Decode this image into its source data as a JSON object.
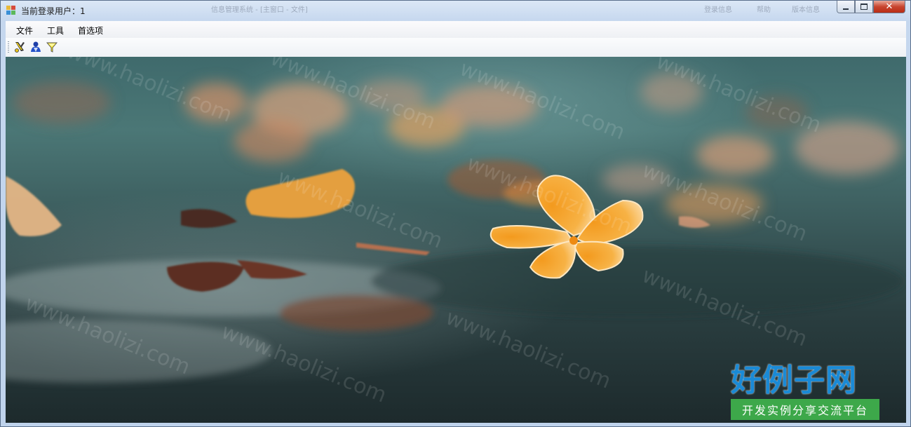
{
  "window": {
    "title": "当前登录用户：1",
    "ghost_title_left": "信息管理系统 - [主窗口 - 文件]",
    "ghost_title_right_1": "登录信息",
    "ghost_title_right_2": "帮助",
    "ghost_title_right_3": "版本信息",
    "caption_close": "✕"
  },
  "menu": {
    "items": [
      {
        "label": "文件"
      },
      {
        "label": "工具"
      },
      {
        "label": "首选项"
      }
    ]
  },
  "toolbar": {
    "buttons": [
      {
        "icon": "tools-icon"
      },
      {
        "icon": "user-icon"
      },
      {
        "icon": "funnel-icon"
      }
    ]
  },
  "watermark": {
    "text": "www.haolizi.com"
  },
  "brand": {
    "title": "好例子网",
    "subtitle": "开发实例分享交流平台"
  },
  "colors": {
    "petal": "#f6a53a",
    "petal_light": "#fde3b8",
    "brand_blue": "#1a8ad6",
    "brand_green": "#3da84a"
  }
}
